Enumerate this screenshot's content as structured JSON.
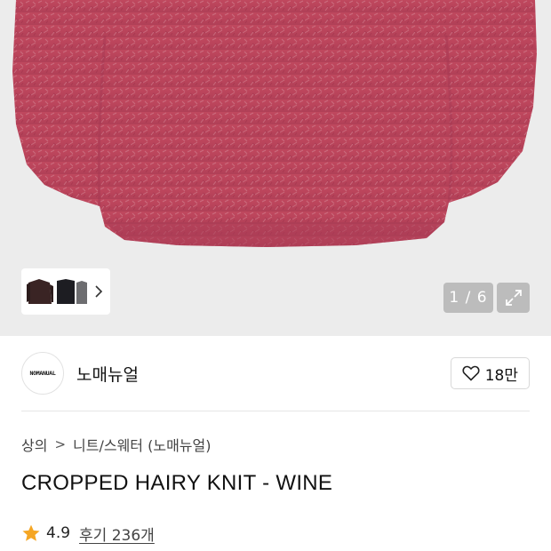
{
  "gallery": {
    "counter": "1 / 6",
    "thumbnail_icon": "chevron-right-icon",
    "expand_icon": "expand-icon"
  },
  "brand": {
    "logo_text": "NOMANUAL",
    "name": "노매뉴얼",
    "like_count": "18만",
    "like_icon": "heart-outline-icon"
  },
  "breadcrumb": {
    "level1": "상의",
    "separator": ">",
    "level2": "니트/스웨터 (노매뉴얼)"
  },
  "product": {
    "title": "CROPPED HAIRY KNIT - WINE"
  },
  "rating": {
    "star_icon": "star-icon",
    "star_color": "#f5a623",
    "score": "4.9",
    "reviews": "후기 236개"
  }
}
